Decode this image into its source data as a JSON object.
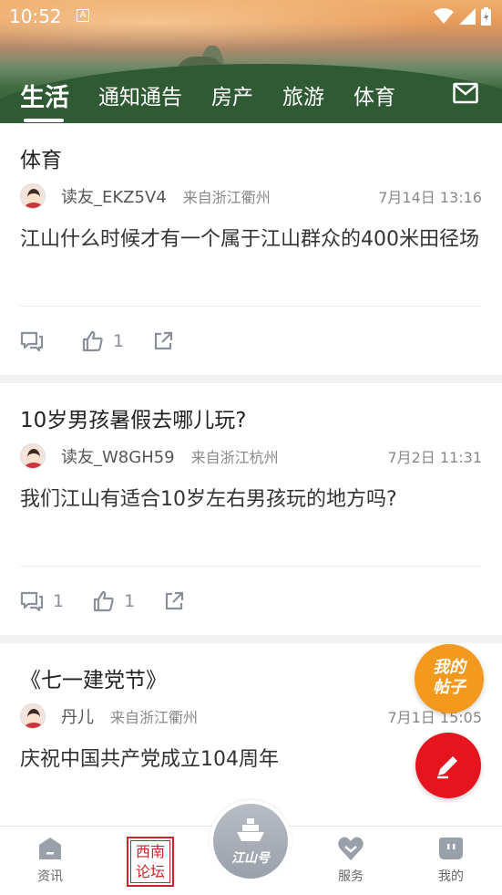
{
  "status_bar": {
    "time": "10:52",
    "badge": "A"
  },
  "tabs": [
    {
      "label": "生活",
      "active": true
    },
    {
      "label": "通知通告",
      "active": false
    },
    {
      "label": "房产",
      "active": false
    },
    {
      "label": "旅游",
      "active": false
    },
    {
      "label": "体育",
      "active": false
    }
  ],
  "posts": [
    {
      "title": "体育",
      "author": "读友_EKZ5V4",
      "source": "来自浙江衢州",
      "date": "7月14日 13:16",
      "content": "江山什么时候才有一个属于江山群众的400米田径场",
      "comments": "",
      "likes": "1"
    },
    {
      "title": "10岁男孩暑假去哪儿玩?",
      "author": "读友_W8GH59",
      "source": "来自浙江杭州",
      "date": "7月2日 11:31",
      "content": "我们江山有适合10岁左右男孩玩的地方吗?",
      "comments": "1",
      "likes": "1"
    },
    {
      "title": "《七一建党节》",
      "author": "丹儿",
      "source": "来自浙江衢州",
      "date": "7月1日 15:05",
      "content": "庆祝中国共产党成立104周年",
      "comments": "",
      "likes": ""
    }
  ],
  "fab": {
    "my_posts_line1": "我的",
    "my_posts_line2": "帖子"
  },
  "bottom_nav": {
    "news": "资讯",
    "forum_line1": "西南",
    "forum_line2": "论坛",
    "center": "江山号",
    "services": "服务",
    "mine": "我的"
  },
  "colors": {
    "accent_red": "#e5141f",
    "accent_orange": "#f39a1e",
    "icon_gray": "#8a8f99"
  }
}
